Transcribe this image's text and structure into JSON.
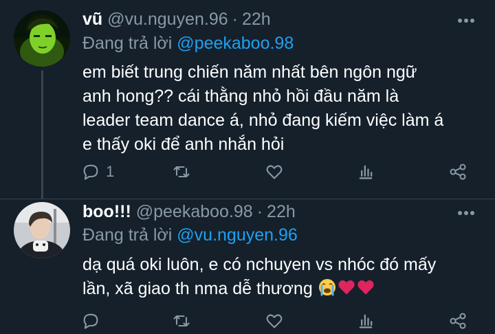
{
  "tweets": [
    {
      "name": "vũ",
      "handle": "@vu.nguyen.96",
      "separator": "·",
      "time": "22h",
      "reply_prefix": "Đang trả lời ",
      "reply_to": "@peekaboo.98",
      "lines": [
        "em biết trung chiến năm nhất bên ngôn ngữ",
        "anh hong?? cái thằng nhỏ hồi đầu năm là",
        "leader team dance á, nhỏ đang kiếm việc làm á",
        "e thấy oki để anh nhắn hỏi"
      ],
      "reply_count": "1",
      "retweet_count": "",
      "like_count": ""
    },
    {
      "name": "boo!!!",
      "handle": "@peekaboo.98",
      "separator": "·",
      "time": "22h",
      "reply_prefix": "Đang trả lời ",
      "reply_to": "@vu.nguyen.96",
      "lines": [
        "dạ quá oki luôn, e có nchuyen vs nhóc đó mấy",
        "lần, xã giao th nma dễ thương"
      ],
      "emojis": [
        "crying-face",
        "red-heart",
        "red-heart"
      ],
      "reply_count": "",
      "retweet_count": "",
      "like_count": ""
    }
  ],
  "colors": {
    "background": "#15202b",
    "muted": "#8899a6",
    "mention": "#1da1f2",
    "heart": "#e0245e"
  },
  "icons": [
    "reply-icon",
    "retweet-icon",
    "like-icon",
    "analytics-icon",
    "share-icon",
    "more-icon"
  ]
}
